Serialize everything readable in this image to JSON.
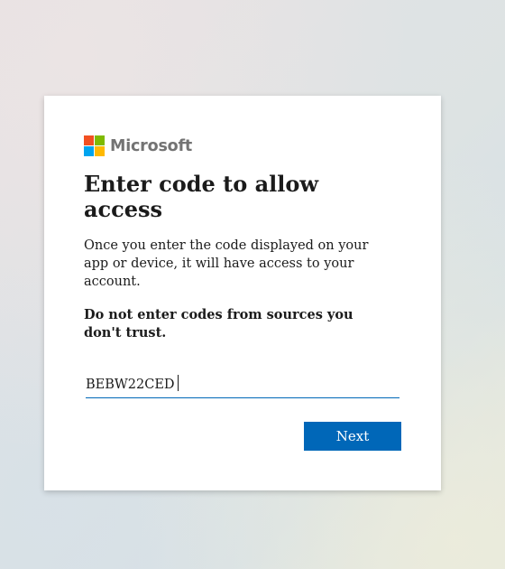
{
  "brand": {
    "name": "Microsoft",
    "logo_colors": {
      "red": "#f25022",
      "green": "#7fba00",
      "blue": "#00a4ef",
      "yellow": "#ffb900"
    },
    "icon": "microsoft-logo"
  },
  "dialog": {
    "title": "Enter code to allow access",
    "description": "Once you enter the code displayed on your app or device, it will have access to your account.",
    "warning": "Do not enter codes from sources you don't trust.",
    "code_input": {
      "value": "BEBW22CED",
      "placeholder": ""
    },
    "next_label": "Next"
  },
  "colors": {
    "accent": "#0067b8",
    "text": "#1b1b1b",
    "logo_text": "#737373",
    "card_background": "#ffffff"
  }
}
